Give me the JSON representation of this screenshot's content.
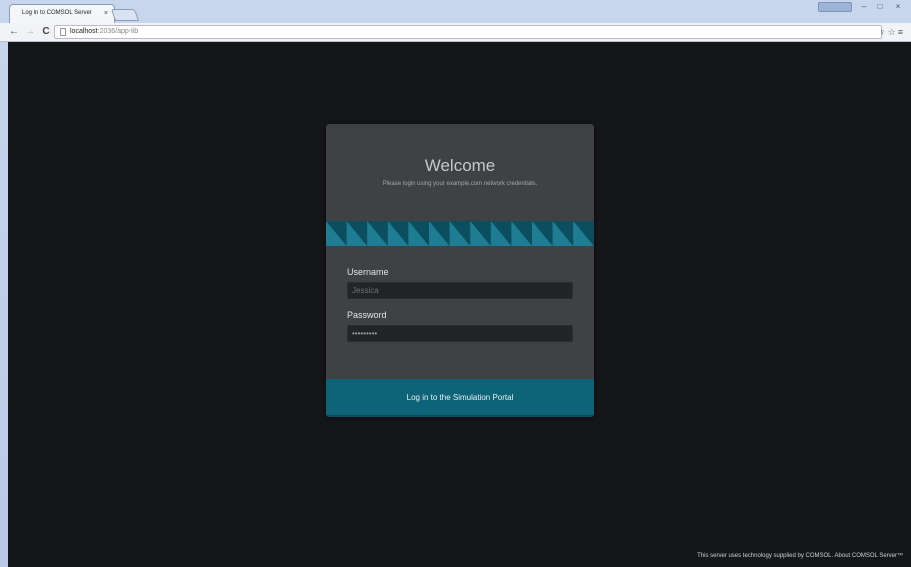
{
  "browser": {
    "tab_title": "Log in to COMSOL Server",
    "tab_close": "×",
    "window_user_badge": "",
    "window_min": "–",
    "window_max": "□",
    "window_close": "×",
    "nav_back": "←",
    "nav_forward": "→",
    "nav_reload": "C",
    "url_host": "localhost",
    "url_rest": ":2036/app-lib",
    "tool_icons": "♀☆≡",
    "icons": [
      "back-arrow-icon",
      "forward-arrow-icon",
      "reload-icon",
      "page-icon",
      "key-icon",
      "star-icon",
      "menu-icon"
    ]
  },
  "login": {
    "title": "Welcome",
    "subtitle": "Please login using your example.com network credentials.",
    "username_label": "Username",
    "username_placeholder": "Jessica",
    "password_label": "Password",
    "password_value": "•••••••••",
    "button_label": "Log in to the Simulation Portal"
  },
  "footer": {
    "text": "This server uses technology supplied by COMSOL. About COMSOL Server™"
  },
  "colors": {
    "page_bg": "#151618",
    "card_bg": "#3f4142",
    "accent": "#0d6478",
    "stripe_light": "#1f7d93",
    "stripe_dark": "#0a4e5f"
  }
}
